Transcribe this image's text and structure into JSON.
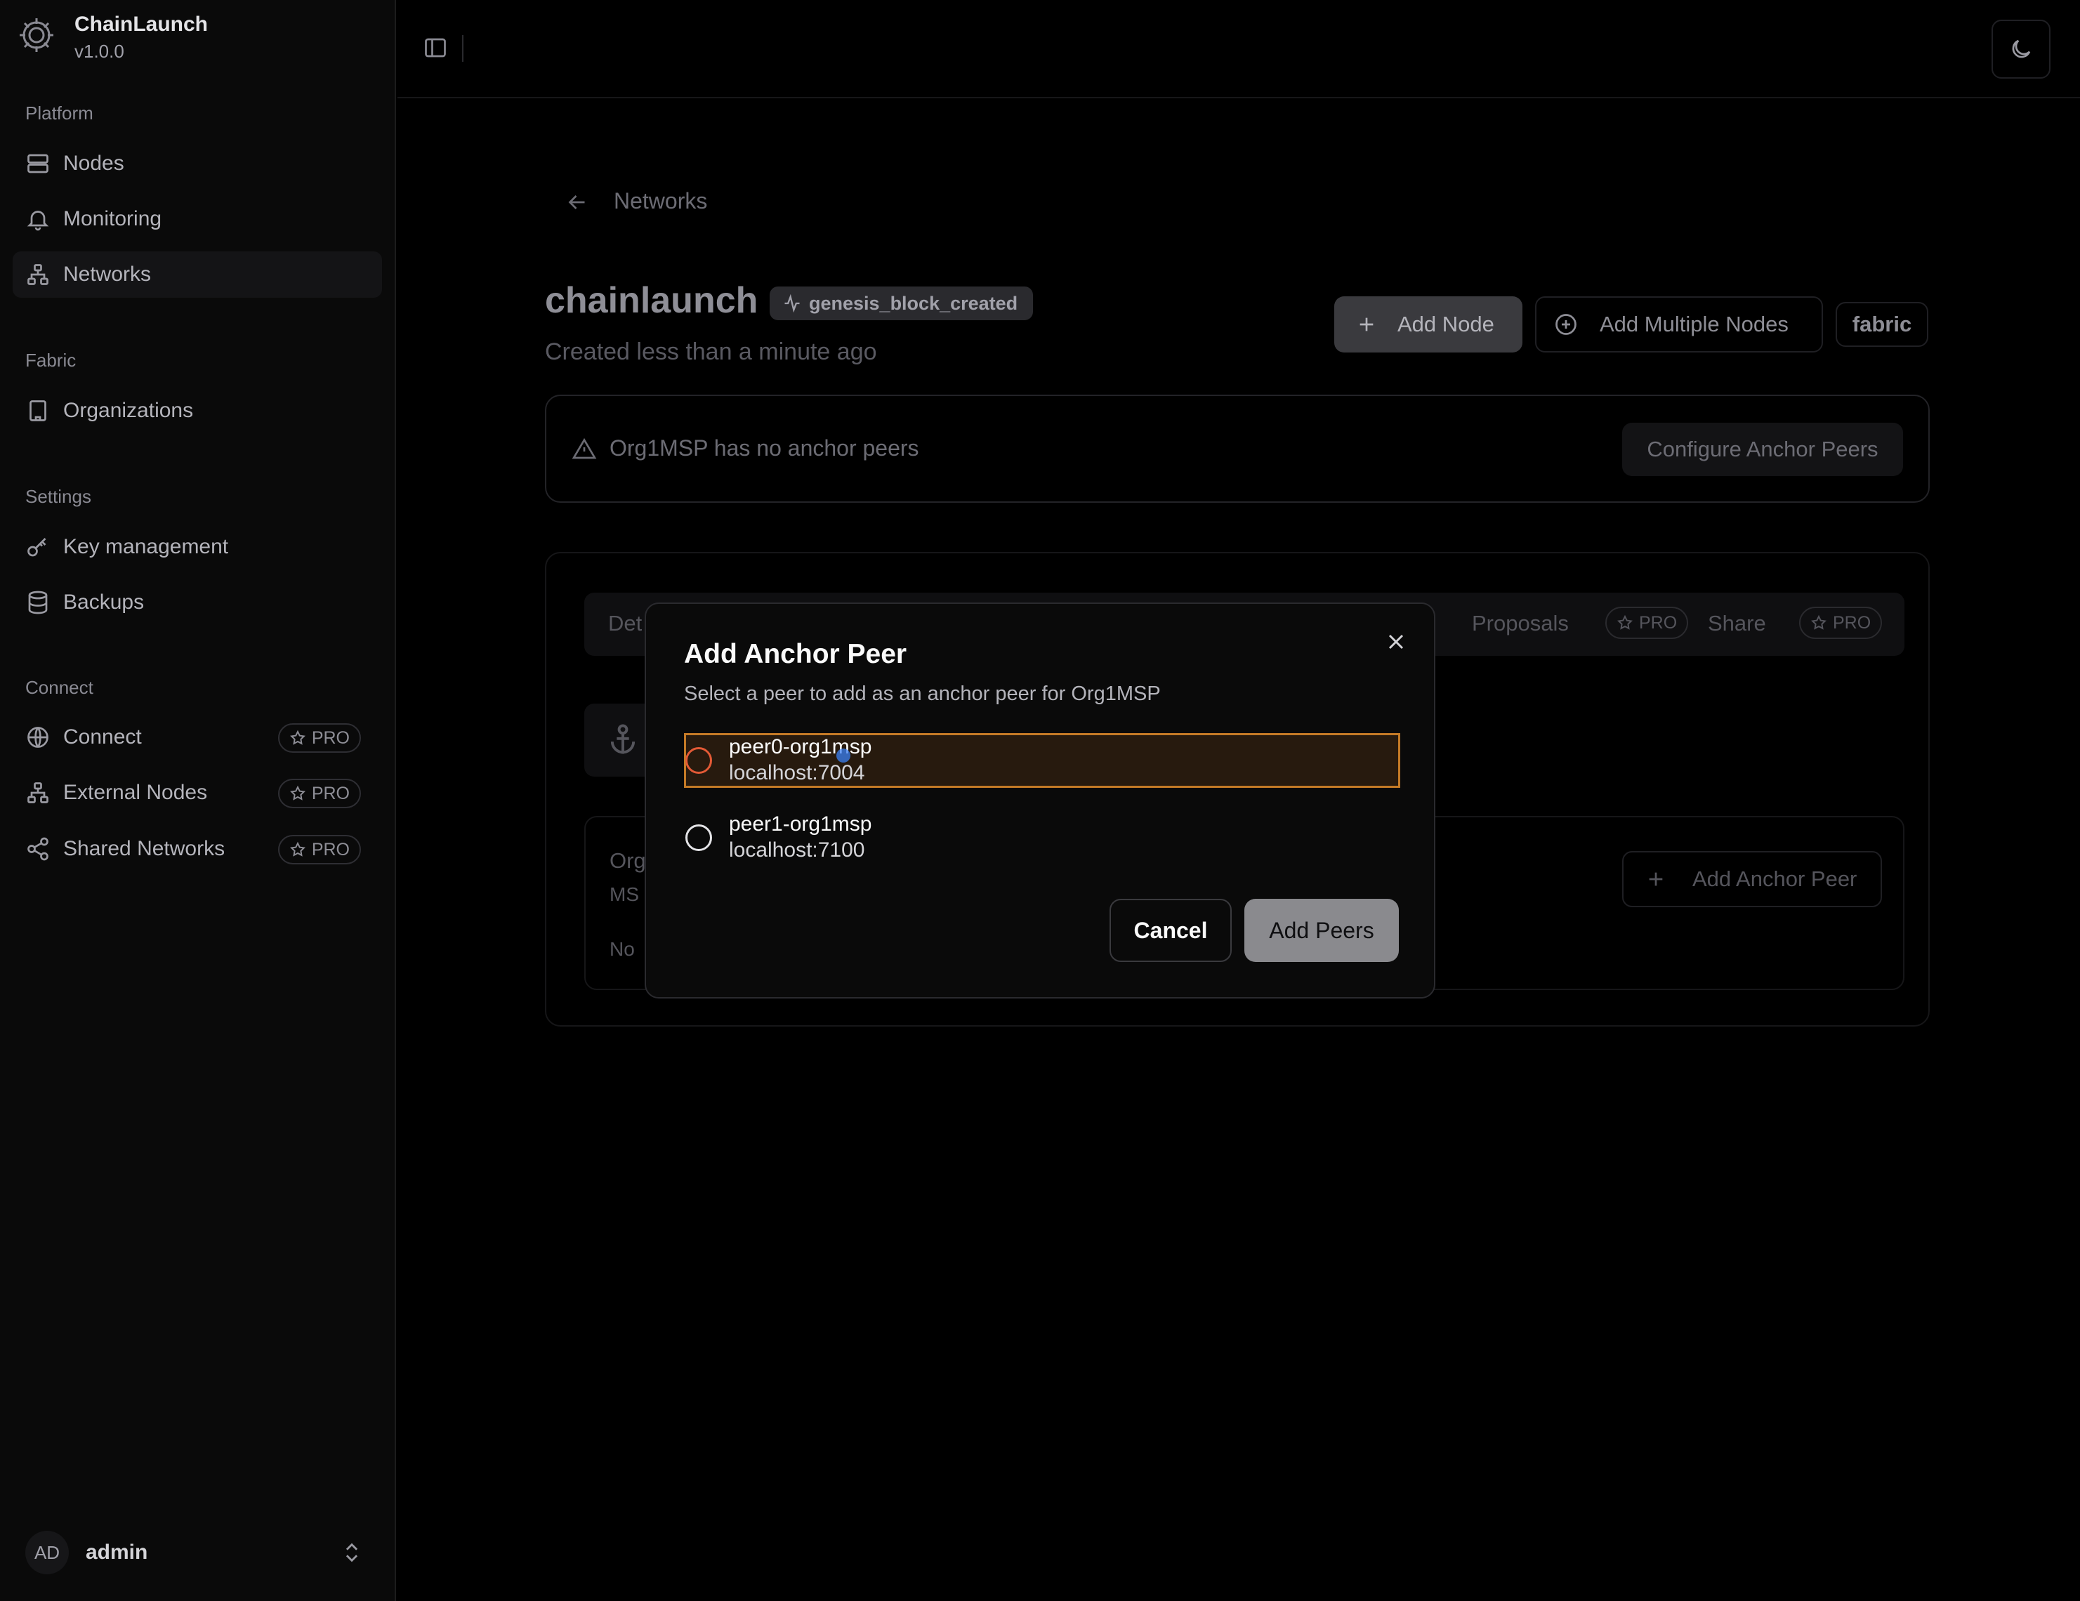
{
  "brand": {
    "name": "ChainLaunch",
    "version": "v1.0.0"
  },
  "sidebar": {
    "sections": [
      {
        "label": "Platform",
        "items": [
          {
            "label": "Nodes",
            "icon": "server-icon"
          },
          {
            "label": "Monitoring",
            "icon": "bell-icon"
          },
          {
            "label": "Networks",
            "icon": "network-icon",
            "active": true
          }
        ]
      },
      {
        "label": "Fabric",
        "items": [
          {
            "label": "Organizations",
            "icon": "building-icon"
          }
        ]
      },
      {
        "label": "Settings",
        "items": [
          {
            "label": "Key management",
            "icon": "key-icon"
          },
          {
            "label": "Backups",
            "icon": "database-icon"
          }
        ]
      },
      {
        "label": "Connect",
        "items": [
          {
            "label": "Connect",
            "icon": "globe-icon",
            "badge": "PRO"
          },
          {
            "label": "External Nodes",
            "icon": "network-icon",
            "badge": "PRO"
          },
          {
            "label": "Shared Networks",
            "icon": "share-icon",
            "badge": "PRO"
          }
        ]
      }
    ],
    "user": {
      "initials": "AD",
      "name": "admin"
    }
  },
  "breadcrumb": {
    "label": "Networks"
  },
  "network": {
    "name": "chainlaunch",
    "status": "genesis_block_created",
    "created": "Created less than a minute ago",
    "type": "fabric"
  },
  "actions": {
    "add_node": "Add Node",
    "add_multiple_nodes": "Add Multiple Nodes"
  },
  "warning": {
    "text": "Org1MSP has no anchor peers",
    "button": "Configure Anchor Peers"
  },
  "tabs": {
    "details_fragment": "Det",
    "proposals": "Proposals",
    "share": "Share",
    "pro_badge": "PRO"
  },
  "org_card": {
    "name_fragment": "Org",
    "msp_fragment": "MS",
    "empty_fragment": "No",
    "add_anchor_peer": "Add Anchor Peer"
  },
  "modal": {
    "title": "Add Anchor Peer",
    "description": "Select a peer to add as an anchor peer for Org1MSP",
    "peers": [
      {
        "name": "peer0-org1msp",
        "host": "localhost:7004",
        "selected": true
      },
      {
        "name": "peer1-org1msp",
        "host": "localhost:7100",
        "selected": false
      }
    ],
    "cancel": "Cancel",
    "submit": "Add Peers"
  },
  "colors": {
    "selected_border": "#c47a26",
    "selected_bg": "#271a0e",
    "radio_selected": "#e35a36"
  }
}
